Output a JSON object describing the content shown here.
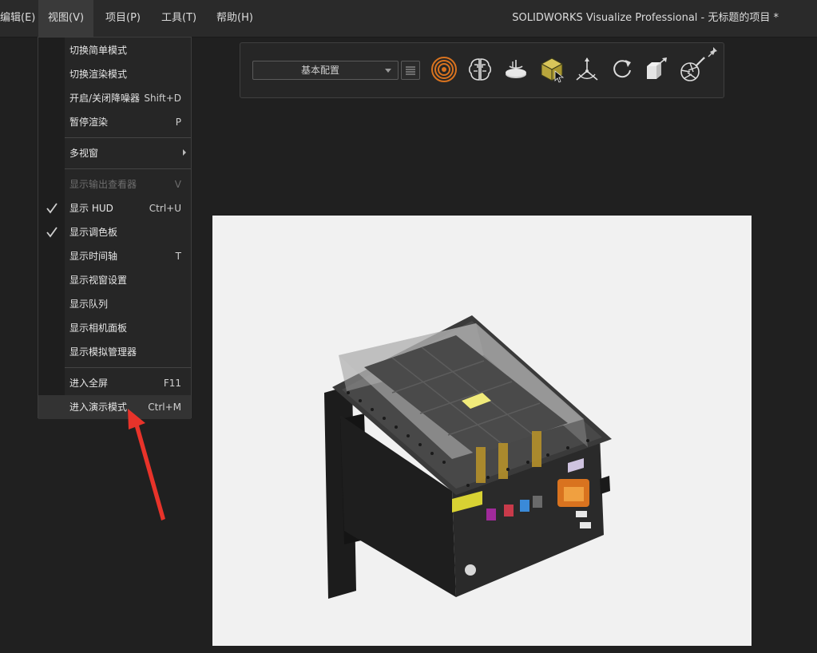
{
  "menubar": {
    "items": [
      {
        "label": "编辑(E)"
      },
      {
        "label": "视图(V)"
      },
      {
        "label": "项目(P)"
      },
      {
        "label": "工具(T)"
      },
      {
        "label": "帮助(H)"
      }
    ],
    "window_title": "SOLIDWORKS Visualize Professional - 无标题的项目 *"
  },
  "view_menu": {
    "items": [
      {
        "label": "切换简单模式",
        "shortcut": ""
      },
      {
        "label": "切换渲染模式",
        "shortcut": ""
      },
      {
        "label": "开启/关闭降噪器",
        "shortcut": "Shift+D"
      },
      {
        "label": "暂停渲染",
        "shortcut": "P"
      },
      {
        "label": "多视窗",
        "shortcut": ""
      },
      {
        "label": "显示输出查看器",
        "shortcut": "V"
      },
      {
        "label": "显示 HUD",
        "shortcut": "Ctrl+U"
      },
      {
        "label": "显示调色板",
        "shortcut": ""
      },
      {
        "label": "显示时间轴",
        "shortcut": "T"
      },
      {
        "label": "显示视窗设置",
        "shortcut": ""
      },
      {
        "label": "显示队列",
        "shortcut": ""
      },
      {
        "label": "显示相机面板",
        "shortcut": ""
      },
      {
        "label": "显示模拟管理器",
        "shortcut": ""
      },
      {
        "label": "进入全屏",
        "shortcut": "F11"
      },
      {
        "label": "进入演示模式",
        "shortcut": "Ctrl+M"
      }
    ]
  },
  "toolbar": {
    "config_value": "基本配置",
    "icons": [
      "render-target-icon",
      "ai-brain-icon",
      "turntable-icon",
      "select-part-icon",
      "triad-icon",
      "rotate-icon",
      "scale-box-icon",
      "camera-edit-icon"
    ]
  },
  "colors": {
    "accent_orange": "#d9731f",
    "highlight_yellow": "#c9b24a",
    "annotation_red": "#e8332a"
  }
}
